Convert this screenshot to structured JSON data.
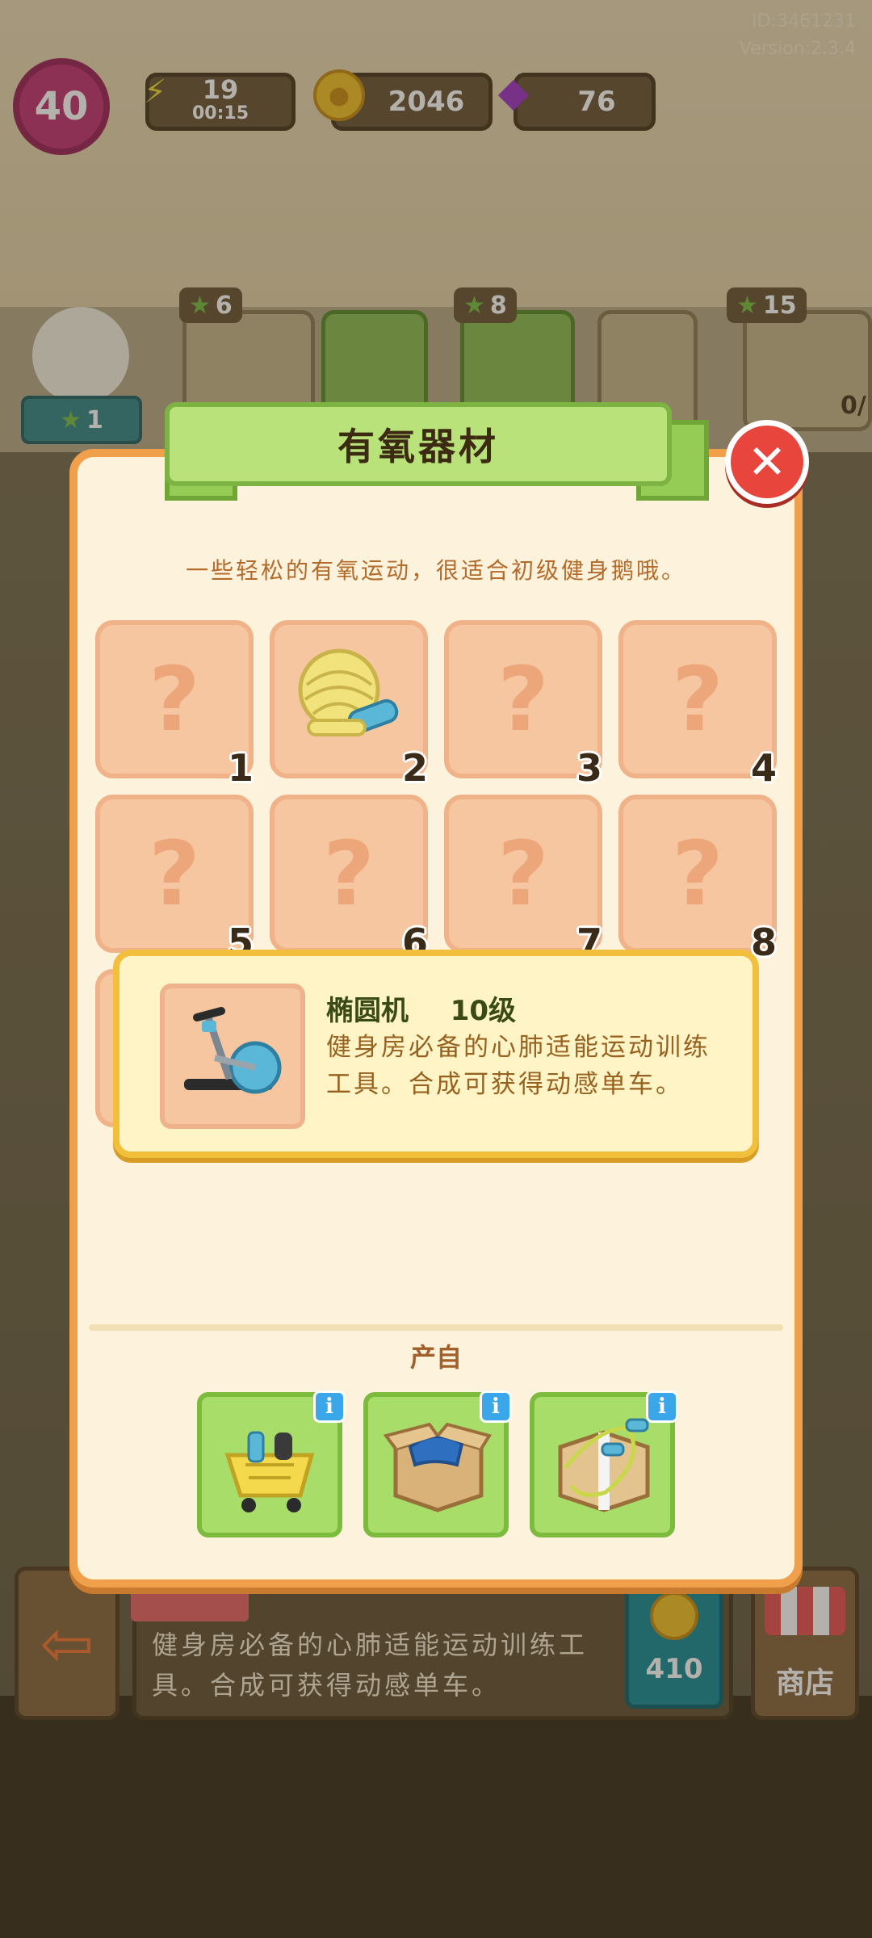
{
  "hud": {
    "player_id": "ID:3461231",
    "version": "Version:2.3.4",
    "level": "40",
    "energy": "19",
    "energy_timer": "00:15",
    "coins": "2046",
    "gems": "76"
  },
  "shelf": {
    "star_counts": [
      "6",
      "8",
      "15"
    ],
    "goose_stars": "1",
    "trophy_progress": "0/"
  },
  "modal": {
    "title": "有氧器材",
    "description": "一些轻松的有氧运动，很适合初级健身鹅哦。",
    "slots": [
      {
        "number": "1",
        "unlocked": false,
        "icon": "question-mark-icon"
      },
      {
        "number": "2",
        "unlocked": true,
        "icon": "yarn-and-foam-roller-icon"
      },
      {
        "number": "3",
        "unlocked": false,
        "icon": "question-mark-icon"
      },
      {
        "number": "4",
        "unlocked": false,
        "icon": "question-mark-icon"
      },
      {
        "number": "5",
        "unlocked": false,
        "icon": "question-mark-icon"
      },
      {
        "number": "6",
        "unlocked": false,
        "icon": "question-mark-icon"
      },
      {
        "number": "7",
        "unlocked": false,
        "icon": "question-mark-icon"
      },
      {
        "number": "8",
        "unlocked": false,
        "icon": "question-mark-icon"
      }
    ],
    "question_glyph": "?",
    "tooltip": {
      "name": "椭圆机",
      "level": "10级",
      "description": "健身房必备的心肺适能运动训练工具。合成可获得动感单车。"
    },
    "produce_label": "产自",
    "produce_items": [
      {
        "name": "cart-with-dumbbells-icon"
      },
      {
        "name": "box-with-clothes-icon"
      },
      {
        "name": "box-with-jump-rope-icon"
      }
    ],
    "info_glyph": "i",
    "close_glyph": "✕"
  },
  "bottom": {
    "description": "健身房必备的心肺适能运动训练工具。合成可获得动感单车。",
    "coin_price": "410",
    "shop_label": "商店"
  },
  "colors": {
    "modal_border": "#f0a04a",
    "ribbon": "#b9e27a",
    "close_button": "#e8463c",
    "slot": "#f6c6a0",
    "tooltip_border": "#f2bf3c",
    "produce_tile": "#a8dd6a"
  }
}
